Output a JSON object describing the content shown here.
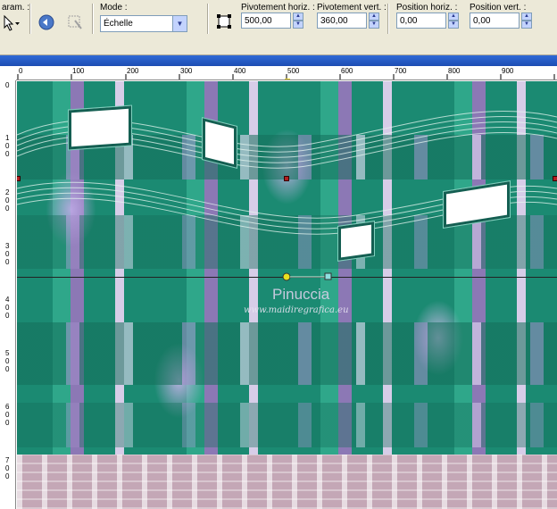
{
  "toolbar": {
    "presets_label": "aram. :",
    "mode_label": "Mode :",
    "mode_value": "Échelle",
    "pivot_h_label": "Pivotement horiz. :",
    "pivot_h_value": "500,00",
    "pivot_v_label": "Pivotement vert. :",
    "pivot_v_value": "360,00",
    "pos_h_label": "Position horiz. :",
    "pos_h_value": "0,00",
    "pos_v_label": "Position vert. :",
    "pos_v_value": "0,00"
  },
  "ruler": {
    "h_ticks": [
      "0",
      "100",
      "200",
      "300",
      "400",
      "500",
      "600",
      "700",
      "800",
      "900"
    ],
    "v_ticks": [
      "0",
      "1 0 0",
      "2 0 0",
      "3 0 0",
      "4 0 0",
      "5 0 0",
      "6 0 0",
      "7 0 0"
    ]
  },
  "watermark": {
    "name": "Pinuccia",
    "url": "www.maidiregrafica.eu"
  },
  "icons": {
    "pointer": "arrow-cursor-icon",
    "reset": "reset-icon",
    "disabled": "disabled-tool-icon",
    "deformation": "deformation-frame-icon"
  }
}
